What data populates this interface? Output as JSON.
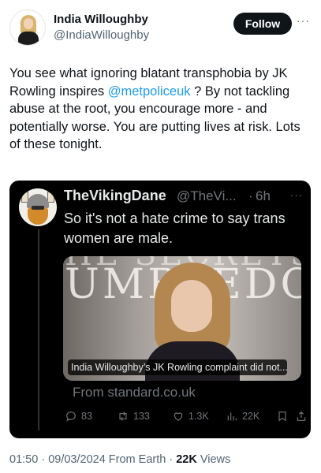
{
  "author": {
    "name": "India Willoughby",
    "handle": "@IndiaWilloughby",
    "follow_label": "Follow",
    "more_label": "···"
  },
  "tweet": {
    "text_before": "You see what ignoring blatant transphobia by JK Rowling inspires ",
    "mention": "@metpoliceuk",
    "text_after": " ? By not tackling abuse at the root, you encourage more - and potentially worse. You are putting lives at risk. Lots of these tonight."
  },
  "quoted": {
    "name": "TheVikingDane",
    "handle": "@TheVi...",
    "separator": "·",
    "time": "6h",
    "more_label": "···",
    "text": "So it's not a hate crime to say trans women are male.",
    "card": {
      "image_lettering_top": "HE SECRETS OF",
      "image_lettering": "UMBLEDO",
      "caption": "India Willoughby’s JK Rowling complaint did not...",
      "source": "From standard.co.uk"
    },
    "actions": {
      "replies": "83",
      "reposts": "133",
      "likes": "1.3K",
      "views": "22K"
    }
  },
  "meta": {
    "time": "01:50",
    "separator1": " · ",
    "date": "09/03/2024",
    "source": " From Earth",
    "separator2": " · ",
    "views_count": "22K",
    "views_label": " Views"
  },
  "colors": {
    "accent": "#1d9bf0",
    "text": "#0f1419",
    "secondary": "#536471",
    "dark_card": "#000000"
  }
}
